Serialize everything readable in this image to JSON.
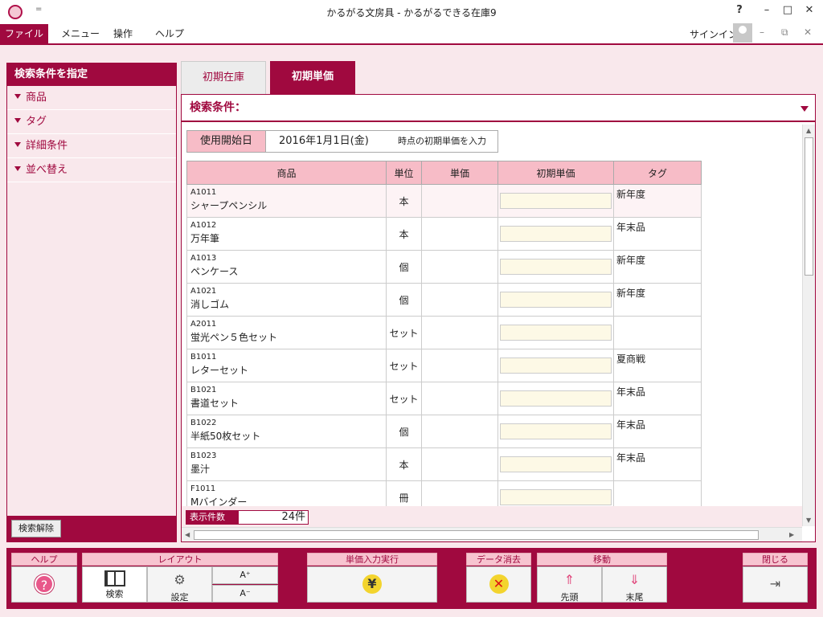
{
  "window": {
    "title": "かるがる文房具 - かるがるできる在庫9",
    "help": "?",
    "minimize": "–",
    "maximize": "□",
    "close": "✕",
    "qat": "="
  },
  "menu": {
    "file": "ファイル",
    "menu": "メニュー",
    "operation": "操作",
    "help": "ヘルプ",
    "signin": "サインイン",
    "ribbon_min": "–",
    "ribbon_restore": "⧉",
    "ribbon_close": "✕"
  },
  "sidebar": {
    "title": "検索条件を指定",
    "items": [
      {
        "label": "商品"
      },
      {
        "label": "タグ"
      },
      {
        "label": "詳細条件"
      },
      {
        "label": "並べ替え"
      }
    ],
    "clear_button": "検索解除"
  },
  "tabs": [
    {
      "label": "初期在庫"
    },
    {
      "label": "初期単価"
    }
  ],
  "search": {
    "label": "検索条件："
  },
  "date_field": {
    "label": "使用開始日",
    "value": "2016年1月1日(金)",
    "suffix": "時点の初期単価を入力"
  },
  "table": {
    "headers": [
      "商品",
      "単位",
      "単価",
      "初期単価",
      "タグ"
    ],
    "rows": [
      {
        "code": "A1011",
        "name": "シャープペンシル",
        "unit": "本",
        "tag": "新年度"
      },
      {
        "code": "A1012",
        "name": "万年筆",
        "unit": "本",
        "tag": "年末品"
      },
      {
        "code": "A1013",
        "name": "ペンケース",
        "unit": "個",
        "tag": "新年度"
      },
      {
        "code": "A1021",
        "name": "消しゴム",
        "unit": "個",
        "tag": "新年度"
      },
      {
        "code": "A2011",
        "name": "蛍光ペン５色セット",
        "unit": "セット",
        "tag": ""
      },
      {
        "code": "B1011",
        "name": "レターセット",
        "unit": "セット",
        "tag": "夏商戦"
      },
      {
        "code": "B1021",
        "name": "書道セット",
        "unit": "セット",
        "tag": "年末品"
      },
      {
        "code": "B1022",
        "name": "半紙50枚セット",
        "unit": "個",
        "tag": "年末品"
      },
      {
        "code": "B1023",
        "name": "墨汁",
        "unit": "本",
        "tag": "年末品"
      },
      {
        "code": "F1011",
        "name": "Mバインダー",
        "unit": "冊",
        "tag": ""
      }
    ]
  },
  "count": {
    "label": "表示件数",
    "value": "24件"
  },
  "toolbar": {
    "help": {
      "label": "ヘルプ"
    },
    "layout": {
      "label": "レイアウト",
      "search": "検索",
      "settings": "設定",
      "font_up": "A⁺",
      "font_down": "A⁻"
    },
    "execute": {
      "label": "単価入力実行"
    },
    "delete": {
      "label": "データ消去"
    },
    "move": {
      "label": "移動",
      "first": "先頭",
      "last": "末尾"
    },
    "close": {
      "label": "閉じる"
    }
  },
  "colors": {
    "accent": "#a0093f",
    "header_pink": "#f7bcc7",
    "background": "#f9e8ec",
    "input_bg": "#fdf9e6"
  }
}
